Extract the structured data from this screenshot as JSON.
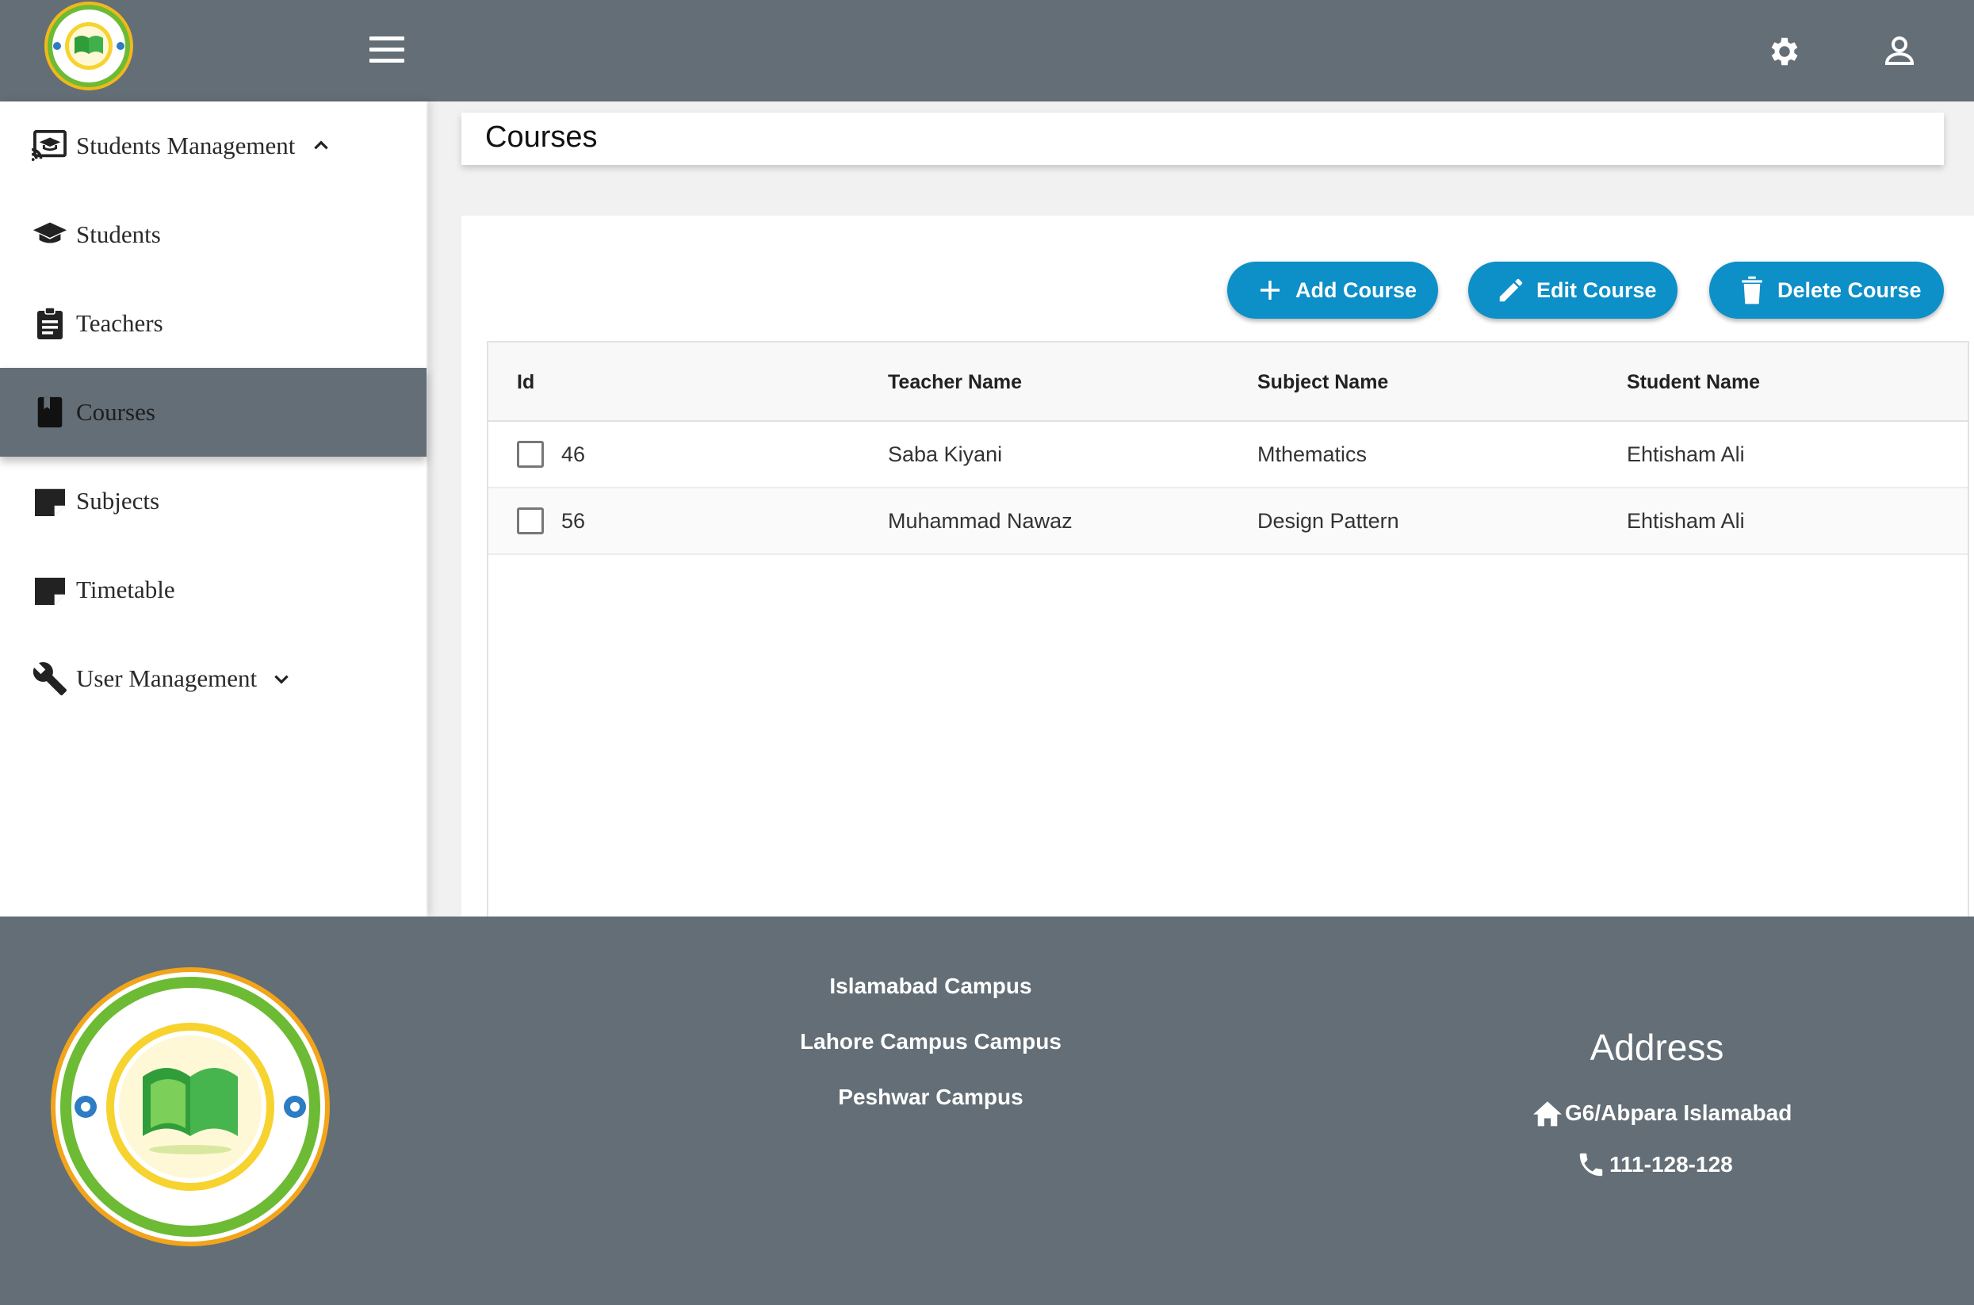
{
  "header": {
    "menu_icon": "hamburger-icon",
    "settings_icon": "gear-icon",
    "account_icon": "account-icon",
    "logo": "school-logo"
  },
  "sidebar": {
    "items": [
      {
        "label": "Students Management",
        "icon": "cast-education-icon",
        "chevron": "up"
      },
      {
        "label": "Students",
        "icon": "graduation-cap-icon"
      },
      {
        "label": "Teachers",
        "icon": "clipboard-icon"
      },
      {
        "label": "Courses",
        "icon": "book-icon",
        "active": true
      },
      {
        "label": "Subjects",
        "icon": "note-icon"
      },
      {
        "label": "Timetable",
        "icon": "note-icon"
      },
      {
        "label": "User Management",
        "icon": "wrench-icon",
        "chevron": "down"
      }
    ]
  },
  "main": {
    "page_title": "Courses",
    "buttons": {
      "add": "Add Course",
      "edit": "Edit Course",
      "delete": "Delete Course"
    },
    "accent": "#0d8fc8",
    "table": {
      "columns": [
        "Id",
        "Teacher Name",
        "Subject Name",
        "Student Name"
      ],
      "rows": [
        {
          "id": "46",
          "teacher": "Saba Kiyani",
          "subject": "Mthematics",
          "student": "Ehtisham Ali"
        },
        {
          "id": "56",
          "teacher": "Muhammad Nawaz",
          "subject": "Design Pattern",
          "student": "Ehtisham Ali"
        }
      ]
    }
  },
  "footer": {
    "campuses": [
      "Islamabad Campus",
      "Lahore Campus Campus",
      "Peshwar Campus"
    ],
    "address_title": "Address",
    "address": "G6/Abpara Islamabad",
    "phone": "111-128-128",
    "bg_color": "#636e76"
  }
}
